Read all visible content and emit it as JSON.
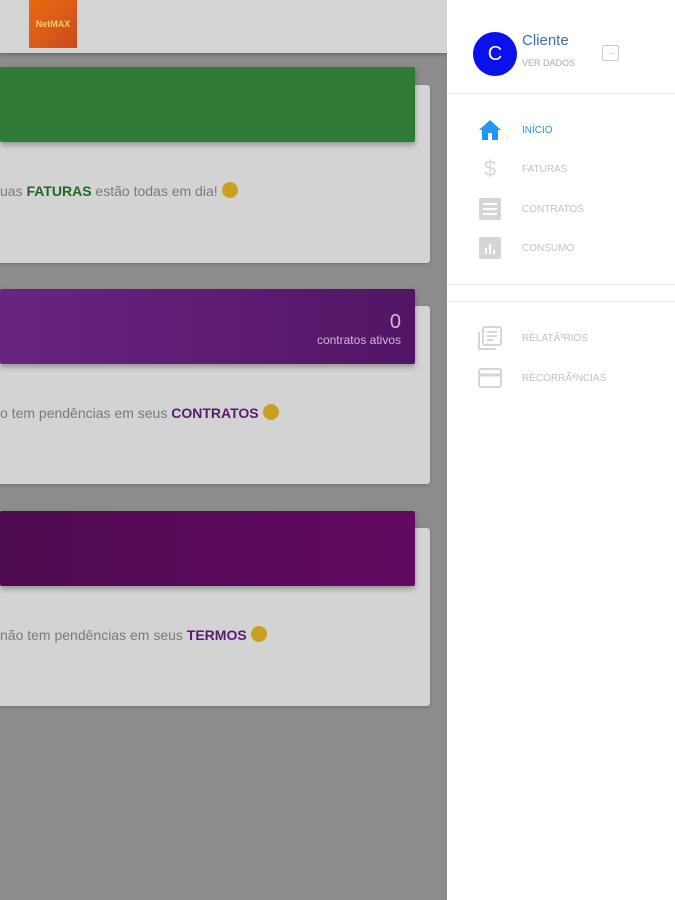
{
  "header": {
    "logo_text": "NetMAX"
  },
  "cards": [
    {
      "message_pre": "uas ",
      "message_bold": "FATURAS",
      "message_post": " estão todas em dia!",
      "bar_color": "#2f7a34",
      "bold_color": "#1f6a22"
    },
    {
      "count": "0",
      "count_label": "contratos ativos",
      "message_pre": "o tem pendências em seus ",
      "message_bold": "CONTRATOS",
      "bold_color": "#5a1a70"
    },
    {
      "message_pre": "não tem pendências em seus ",
      "message_bold": "TERMOS",
      "bold_color": "#5a1a70"
    }
  ],
  "drawer": {
    "avatar_letter": "C",
    "user_name": "Cliente",
    "view_data": "VER DADOS",
    "items": [
      {
        "label": "INÍCIO",
        "icon": "home-icon"
      },
      {
        "label": "FATURAS",
        "icon": "dollar-icon"
      },
      {
        "label": "CONTRATOS",
        "icon": "list-icon"
      },
      {
        "label": "CONSUMO",
        "icon": "chart-icon"
      },
      {
        "label": "RELATÃ³RIOS",
        "icon": "reports-icon"
      },
      {
        "label": "RECORRÃªNCIAS",
        "icon": "card-icon"
      }
    ]
  }
}
